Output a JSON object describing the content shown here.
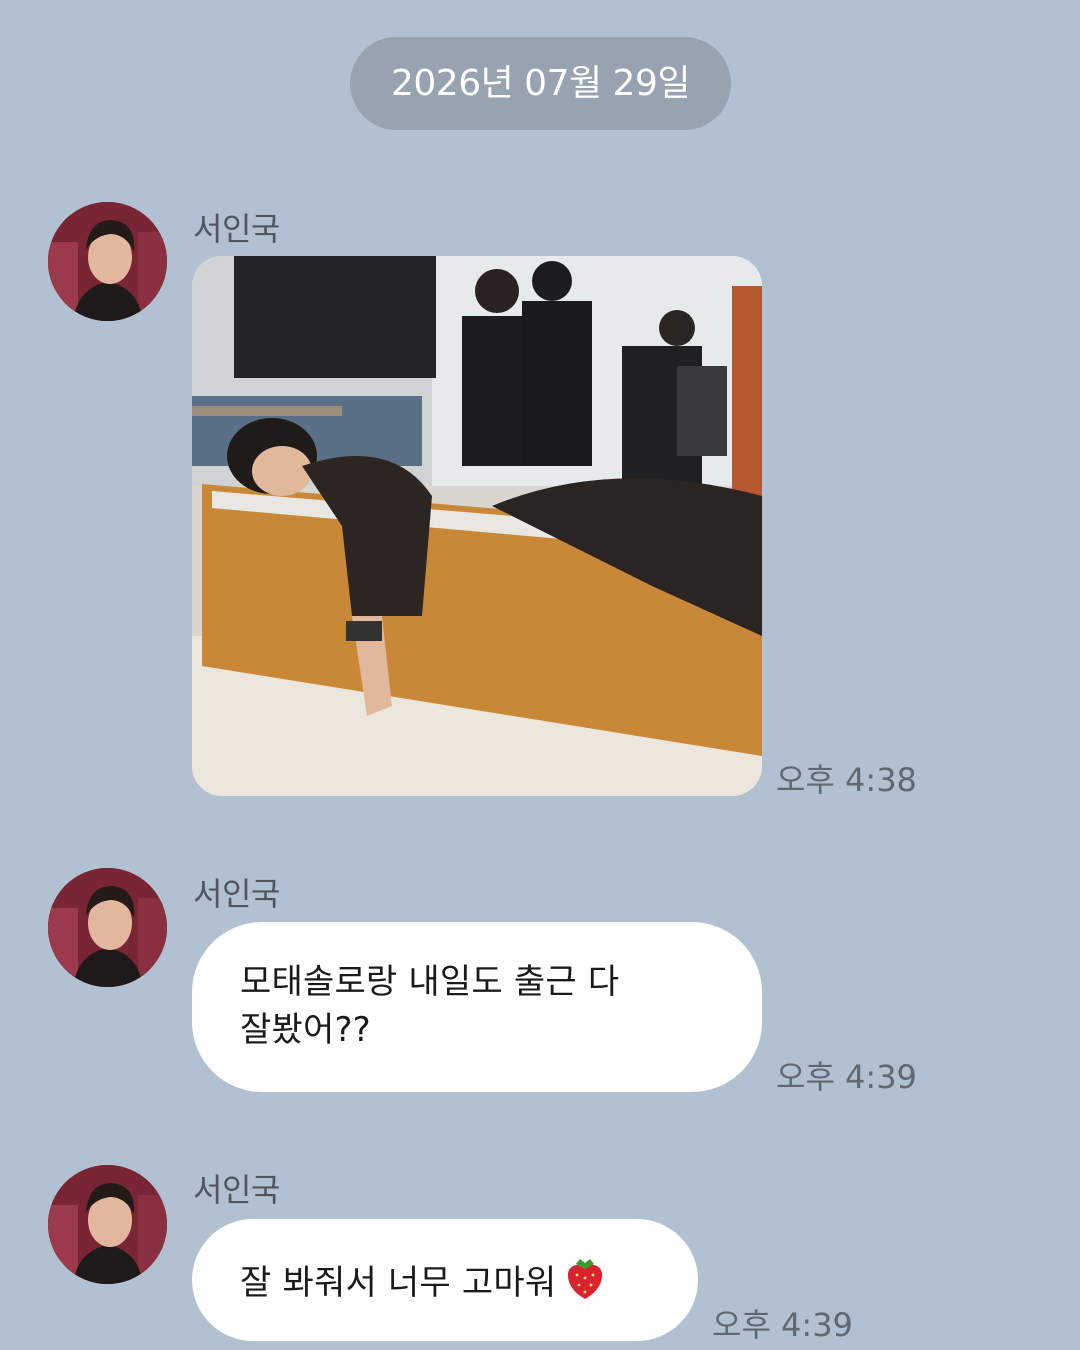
{
  "date_divider": "2026년 07월 29일",
  "messages": [
    {
      "sender": "서인국",
      "type": "image",
      "time": "오후 4:38"
    },
    {
      "sender": "서인국",
      "type": "text",
      "text_line1": "모태솔로랑 내일도 출근 다",
      "text_line2": "잘봤어??",
      "time": "오후 4:39"
    },
    {
      "sender": "서인국",
      "type": "text",
      "text": "잘 봐줘서 너무 고마워",
      "emoji": "strawberry-icon",
      "time": "오후 4:39"
    }
  ],
  "colors": {
    "background": "#b2c1d1",
    "date_pill": "#97a3b0",
    "bubble": "#ffffff"
  }
}
